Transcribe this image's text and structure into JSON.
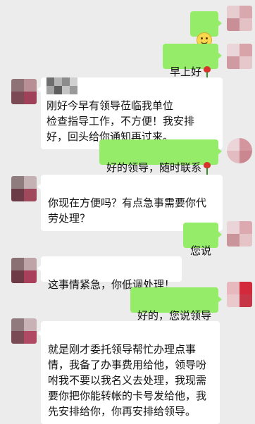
{
  "messages": [
    {
      "side": "out",
      "text": "",
      "emoji": "smile-emoji"
    },
    {
      "side": "out",
      "text": "早上好",
      "emoji": "rose-emoji"
    },
    {
      "side": "in",
      "text": "刚好今早有领导莅临我单位\n检查指导工作，不方便！我安排\n好，回头给你通知再过来。"
    },
    {
      "side": "out",
      "text": "好的领导，随时联系",
      "emoji": "rose-emoji"
    },
    {
      "side": "in",
      "text": "你现在方便吗？有点急事需要你代\n劳处理？"
    },
    {
      "side": "out",
      "text": "您说"
    },
    {
      "side": "in",
      "text": "这事情紧急，你低调处理！"
    },
    {
      "side": "out",
      "text": "好的，您说领导"
    },
    {
      "side": "in",
      "text": "就是刚才委托领导帮忙办理点事\n情，我备了办事费用给他，领导吩\n咐我不要以我名义去处理，我现需\n要你把你能转帐的卡号发给他，我\n先安排给你，你再安排给领导。"
    }
  ],
  "colors": {
    "outgoing_bubble": "#95ec69",
    "incoming_bubble": "#ffffff",
    "background": "#ececec"
  }
}
